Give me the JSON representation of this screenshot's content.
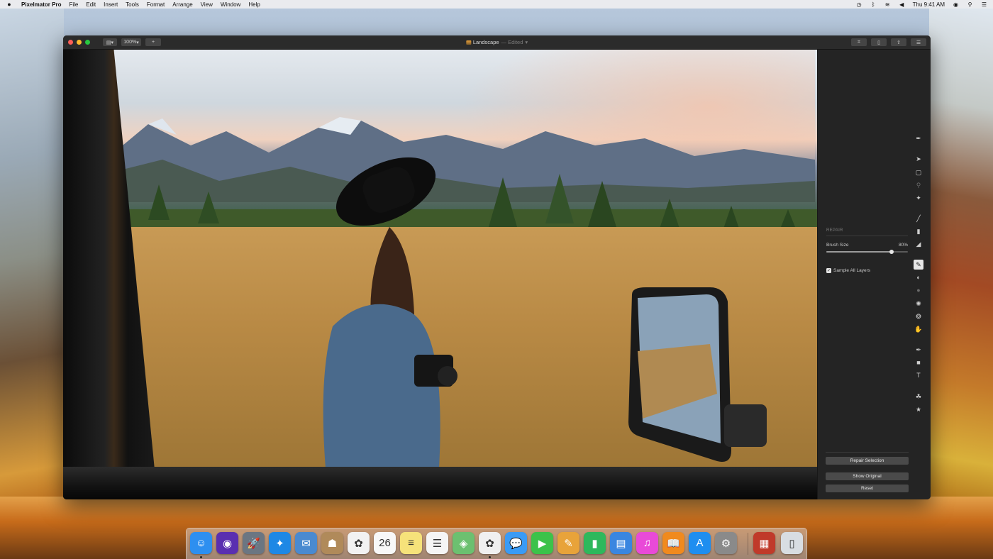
{
  "menubar": {
    "app_name": "Pixelmator Pro",
    "items": [
      "File",
      "Edit",
      "Insert",
      "Tools",
      "Format",
      "Arrange",
      "View",
      "Window",
      "Help"
    ],
    "clock": "Thu 9:41 AM"
  },
  "window": {
    "title": "Landscape",
    "edited_label": "— Edited",
    "zoom": "100%",
    "add_label": "+"
  },
  "panel": {
    "section_title": "REPAIR",
    "brush_size_label": "Brush Size",
    "brush_size_value": "80%",
    "brush_size_fraction": 0.8,
    "sample_all_layers_label": "Sample All Layers",
    "sample_all_layers_checked": true,
    "repair_selection_label": "Repair Selection",
    "show_original_label": "Show Original",
    "reset_label": "Reset"
  },
  "tools": [
    {
      "name": "style-tool-icon",
      "glyph": "✒"
    },
    {
      "name": "arrange-tool-icon",
      "glyph": "➤"
    },
    {
      "name": "selection-tool-icon",
      "glyph": "▢"
    },
    {
      "name": "lasso-tool-icon",
      "glyph": "⚲"
    },
    {
      "name": "quick-selection-tool-icon",
      "glyph": "✦"
    },
    {
      "name": "paint-tool-icon",
      "glyph": "╱"
    },
    {
      "name": "fill-tool-icon",
      "glyph": "▮"
    },
    {
      "name": "erase-tool-icon",
      "glyph": "◢"
    },
    {
      "name": "repair-tool-icon",
      "glyph": "✎"
    },
    {
      "name": "clone-tool-icon",
      "glyph": "◐"
    },
    {
      "name": "blur-tool-icon",
      "glyph": "●"
    },
    {
      "name": "lighten-tool-icon",
      "glyph": "✺"
    },
    {
      "name": "sponge-tool-icon",
      "glyph": "❂"
    },
    {
      "name": "warp-tool-icon",
      "glyph": "✋"
    },
    {
      "name": "pen-tool-icon",
      "glyph": "✒"
    },
    {
      "name": "shape-tool-icon",
      "glyph": "■"
    },
    {
      "name": "type-tool-icon",
      "glyph": "T"
    },
    {
      "name": "color-adjust-tool-icon",
      "glyph": "☘"
    },
    {
      "name": "effects-tool-icon",
      "glyph": "★"
    }
  ],
  "dock": [
    {
      "name": "finder-icon",
      "glyph": "☺",
      "color": "#2d8ff0",
      "running": true
    },
    {
      "name": "siri-icon",
      "glyph": "◉",
      "color": "#5a2fb0",
      "running": false
    },
    {
      "name": "launchpad-icon",
      "glyph": "🚀",
      "color": "#6b7682",
      "running": false
    },
    {
      "name": "safari-icon",
      "glyph": "✦",
      "color": "#1e88e5",
      "running": false
    },
    {
      "name": "mail-icon",
      "glyph": "✉",
      "color": "#4a8ad0",
      "running": false
    },
    {
      "name": "contacts-icon",
      "glyph": "☗",
      "color": "#b08a5a",
      "running": false
    },
    {
      "name": "photos-icon",
      "glyph": "✿",
      "color": "#f2f2f2",
      "running": false
    },
    {
      "name": "calendar-icon",
      "glyph": "26",
      "color": "#f8f8f8",
      "running": false
    },
    {
      "name": "notes-icon",
      "glyph": "≡",
      "color": "#f6e27a",
      "running": false
    },
    {
      "name": "reminders-icon",
      "glyph": "☰",
      "color": "#f5f5f5",
      "running": false
    },
    {
      "name": "maps-icon",
      "glyph": "◈",
      "color": "#6cc070",
      "running": false
    },
    {
      "name": "pixelmator-pro-icon",
      "glyph": "✿",
      "color": "#f0f0f0",
      "running": true
    },
    {
      "name": "messages-icon",
      "glyph": "💬",
      "color": "#3a9bf5",
      "running": false
    },
    {
      "name": "facetime-icon",
      "glyph": "▶",
      "color": "#3cc24a",
      "running": false
    },
    {
      "name": "pages-icon",
      "glyph": "✎",
      "color": "#e8a33a",
      "running": false
    },
    {
      "name": "numbers-icon",
      "glyph": "▮",
      "color": "#2eb85c",
      "running": false
    },
    {
      "name": "keynote-icon",
      "glyph": "▤",
      "color": "#3a86e0",
      "running": false
    },
    {
      "name": "itunes-icon",
      "glyph": "♫",
      "color": "#e94ad8",
      "running": false
    },
    {
      "name": "ibooks-icon",
      "glyph": "📖",
      "color": "#f08a1e",
      "running": false
    },
    {
      "name": "app-store-icon",
      "glyph": "A",
      "color": "#1e8ef0",
      "running": false
    },
    {
      "name": "system-preferences-icon",
      "glyph": "⚙",
      "color": "#8a8a8a",
      "running": false
    },
    {
      "name": "photo-folder-icon",
      "glyph": "▦",
      "color": "#c03a2a",
      "running": false
    },
    {
      "name": "trash-icon",
      "glyph": "▯",
      "color": "#d8dde2",
      "running": false
    }
  ]
}
